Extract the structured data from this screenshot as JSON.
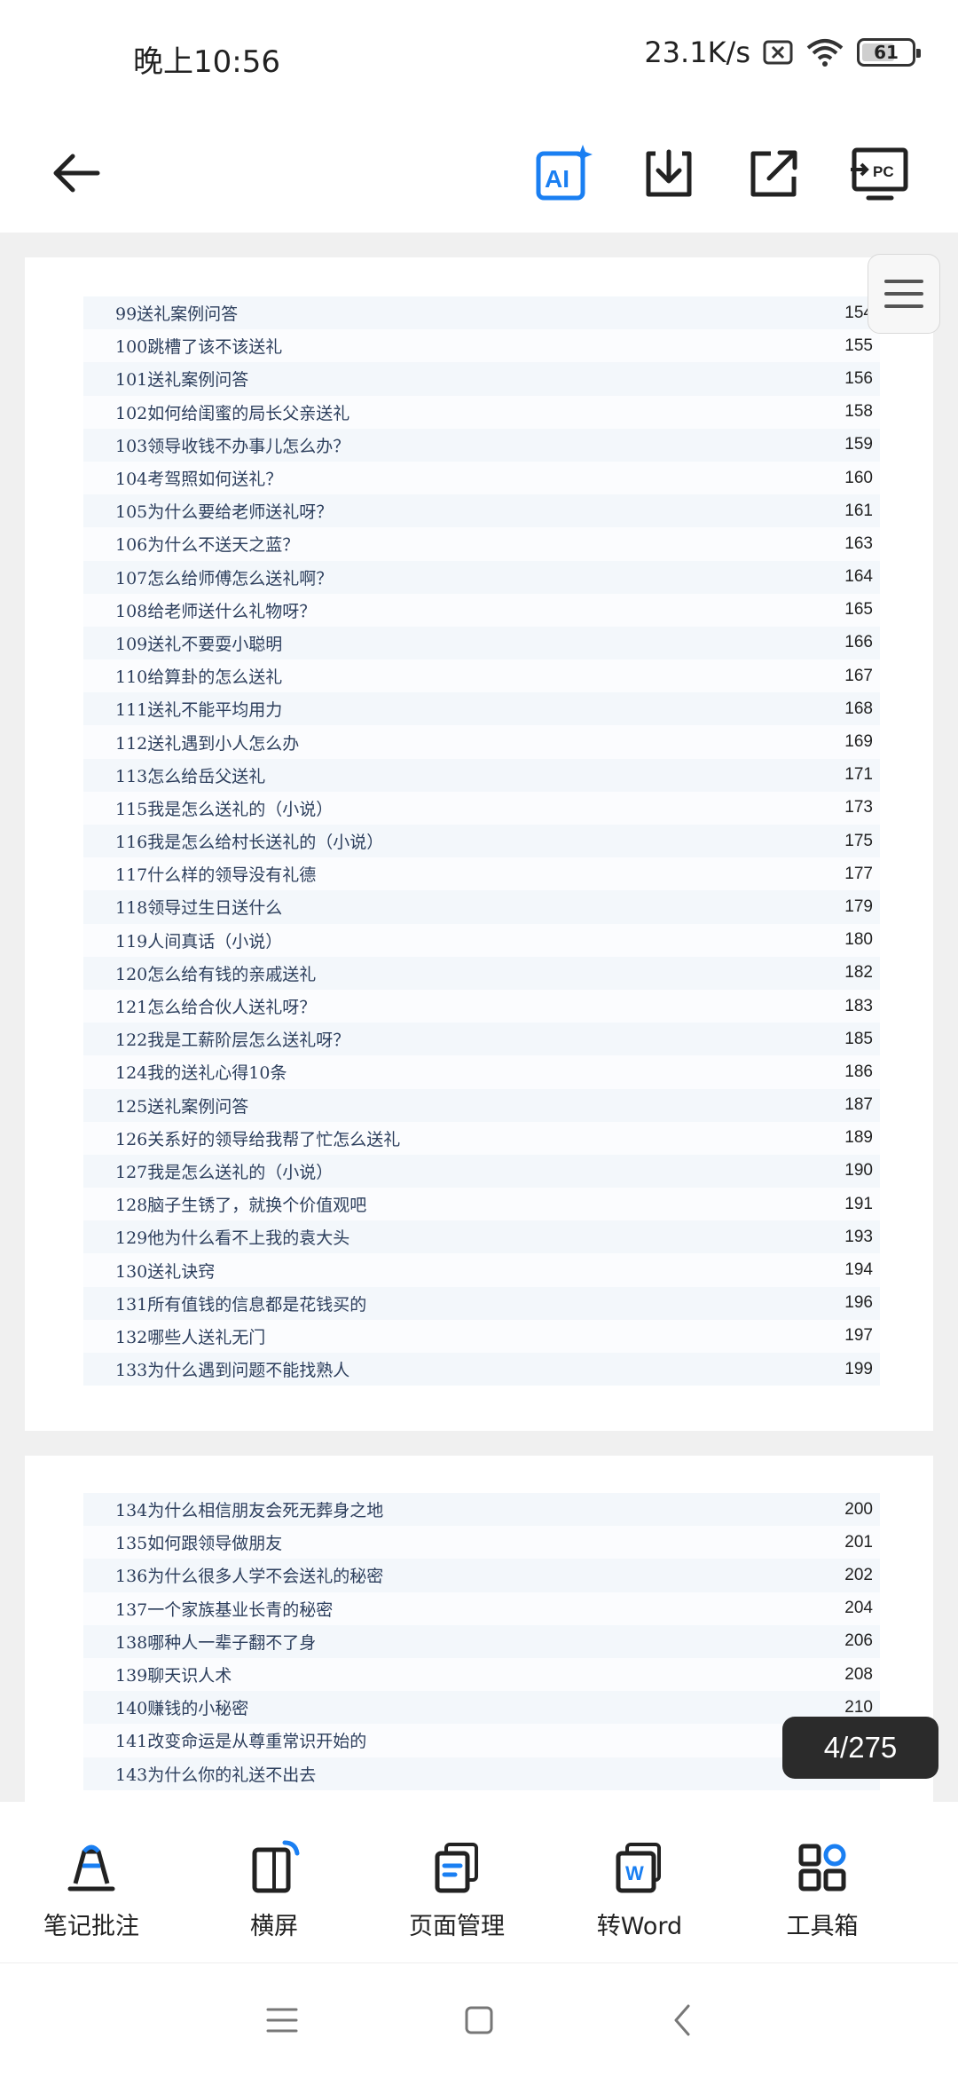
{
  "status": {
    "time": "晚上10:56",
    "network_speed": "23.1K/s",
    "battery": "61"
  },
  "toolbar": {
    "back_icon": "arrow-left-icon",
    "buttons": [
      {
        "name": "ai-assistant",
        "icon": "ai-sparkle-icon",
        "label": "AI"
      },
      {
        "name": "download",
        "icon": "download-icon"
      },
      {
        "name": "share",
        "icon": "share-export-icon"
      },
      {
        "name": "cast-to-pc",
        "icon": "pc-cast-icon",
        "label": "PC"
      }
    ]
  },
  "document": {
    "page1_entries": [
      {
        "title": "99送礼案例问答",
        "page": "154"
      },
      {
        "title": "100跳槽了该不该送礼",
        "page": "155"
      },
      {
        "title": "101送礼案例问答",
        "page": "156"
      },
      {
        "title": "102如何给闺蜜的局长父亲送礼",
        "page": "158"
      },
      {
        "title": "103领导收钱不办事儿怎么办？",
        "page": "159"
      },
      {
        "title": "104考驾照如何送礼？",
        "page": "160"
      },
      {
        "title": "105为什么要给老师送礼呀？",
        "page": "161"
      },
      {
        "title": "106为什么不送天之蓝？",
        "page": "163"
      },
      {
        "title": "107怎么给师傅怎么送礼啊？",
        "page": "164"
      },
      {
        "title": "108给老师送什么礼物呀？",
        "page": "165"
      },
      {
        "title": "109送礼不要耍小聪明",
        "page": "166"
      },
      {
        "title": "110给算卦的怎么送礼",
        "page": "167"
      },
      {
        "title": "111送礼不能平均用力",
        "page": "168"
      },
      {
        "title": "112送礼遇到小人怎么办",
        "page": "169"
      },
      {
        "title": "113怎么给岳父送礼",
        "page": "171"
      },
      {
        "title": "115我是怎么送礼的（小说）",
        "page": "173"
      },
      {
        "title": "116我是怎么给村长送礼的（小说）",
        "page": "175"
      },
      {
        "title": "117什么样的领导没有礼德",
        "page": "177"
      },
      {
        "title": "118领导过生日送什么",
        "page": "179"
      },
      {
        "title": "119人间真话（小说）",
        "page": "180"
      },
      {
        "title": "120怎么给有钱的亲戚送礼",
        "page": "182"
      },
      {
        "title": "121怎么给合伙人送礼呀？",
        "page": "183"
      },
      {
        "title": "122我是工薪阶层怎么送礼呀？",
        "page": "185"
      },
      {
        "title": "124我的送礼心得10条",
        "page": "186"
      },
      {
        "title": "125送礼案例问答",
        "page": "187"
      },
      {
        "title": "126关系好的领导给我帮了忙怎么送礼",
        "page": "189"
      },
      {
        "title": "127我是怎么送礼的（小说）",
        "page": "190"
      },
      {
        "title": "128脑子生锈了，就换个价值观吧",
        "page": "191"
      },
      {
        "title": "129他为什么看不上我的袁大头",
        "page": "193"
      },
      {
        "title": "130送礼诀窍",
        "page": "194"
      },
      {
        "title": "131所有值钱的信息都是花钱买的",
        "page": "196"
      },
      {
        "title": "132哪些人送礼无门",
        "page": "197"
      },
      {
        "title": "133为什么遇到问题不能找熟人",
        "page": "199"
      }
    ],
    "page2_entries": [
      {
        "title": "134为什么相信朋友会死无葬身之地",
        "page": "200"
      },
      {
        "title": "135如何跟领导做朋友",
        "page": "201"
      },
      {
        "title": "136为什么很多人学不会送礼的秘密",
        "page": "202"
      },
      {
        "title": "137一个家族基业长青的秘密",
        "page": "204"
      },
      {
        "title": "138哪种人一辈子翻不了身",
        "page": "206"
      },
      {
        "title": "139聊天识人术",
        "page": "208"
      },
      {
        "title": "140赚钱的小秘密",
        "page": "210"
      },
      {
        "title": "141改变命运是从尊重常识开始的",
        "page": ""
      },
      {
        "title": "143为什么你的礼送不出去",
        "page": "213"
      }
    ],
    "page_indicator": "4/275"
  },
  "bottom_tools": [
    {
      "label": "笔记批注",
      "icon": "annotate-pen-icon"
    },
    {
      "label": "横屏",
      "icon": "rotate-landscape-icon"
    },
    {
      "label": "页面管理",
      "icon": "page-manage-icon"
    },
    {
      "label": "转Word",
      "icon": "word-convert-icon"
    },
    {
      "label": "工具箱",
      "icon": "toolbox-grid-icon"
    }
  ],
  "nav": {
    "icons": [
      "menu-lines-icon",
      "home-square-icon",
      "back-chevron-icon"
    ]
  },
  "colors": {
    "accent": "#1a7ff2",
    "toc_text": "#2c3e5c",
    "badge_bg": "#2b2b2b"
  }
}
